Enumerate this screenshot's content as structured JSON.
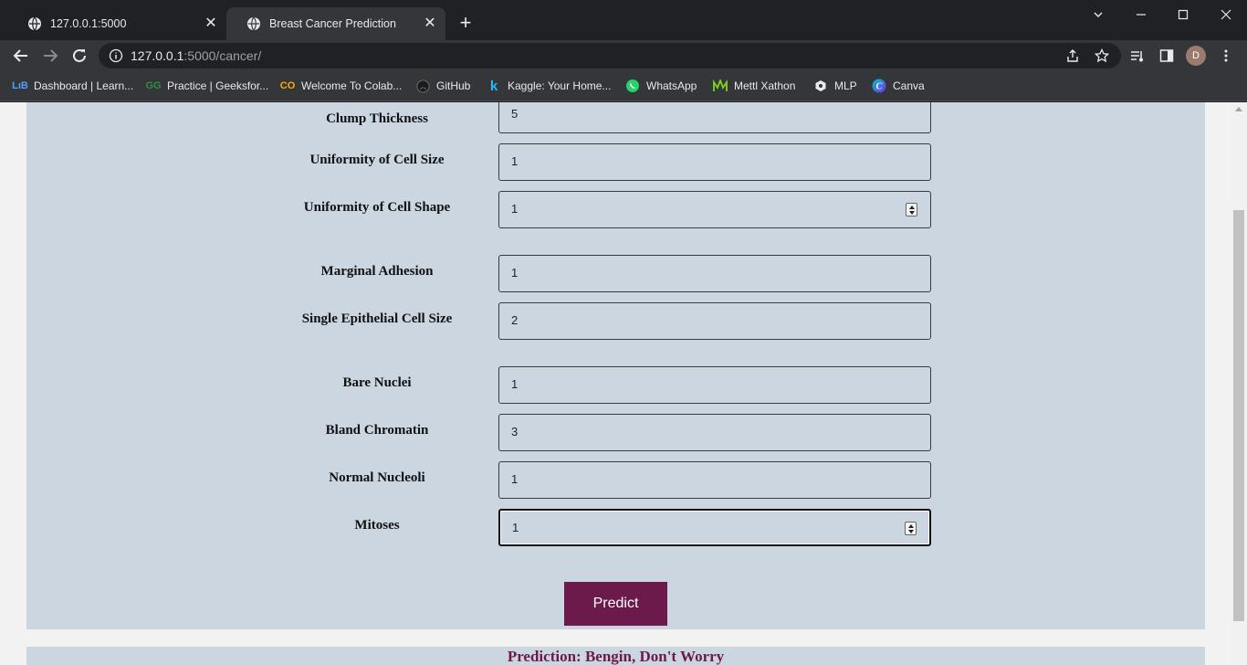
{
  "browser": {
    "tabs": [
      {
        "title": "127.0.0.1:5000"
      },
      {
        "title": "Breast Cancer Prediction"
      }
    ],
    "url_host": "127.0.0.1",
    "url_path": ":5000/cancer/",
    "avatar_letter": "D",
    "bookmarks": [
      {
        "label": "Dashboard | Learn...",
        "icon": "LıB"
      },
      {
        "label": "Practice | Geeksfor...",
        "icon": "GG"
      },
      {
        "label": "Welcome To Colab...",
        "icon": "CO"
      },
      {
        "label": "GitHub",
        "icon": "github-icon"
      },
      {
        "label": "Kaggle: Your Home...",
        "icon": "k"
      },
      {
        "label": "WhatsApp",
        "icon": "whatsapp-icon"
      },
      {
        "label": "Mettl Xathon",
        "icon": "mettl-icon"
      },
      {
        "label": "MLP",
        "icon": "mlp-icon"
      },
      {
        "label": "Canva",
        "icon": "C"
      }
    ]
  },
  "form": {
    "fields": [
      {
        "label": "Clump Thickness",
        "value": "5",
        "spinner": false
      },
      {
        "label": "Uniformity of Cell Size",
        "value": "1",
        "spinner": false
      },
      {
        "label": "Uniformity of Cell Shape",
        "value": "1",
        "spinner": true
      },
      {
        "label": "Marginal Adhesion",
        "value": "1",
        "spinner": false
      },
      {
        "label": "Single Epithelial Cell Size",
        "value": "2",
        "spinner": false
      },
      {
        "label": "Bare Nuclei",
        "value": "1",
        "spinner": false
      },
      {
        "label": "Bland Chromatin",
        "value": "3",
        "spinner": false
      },
      {
        "label": "Normal Nucleoli",
        "value": "1",
        "spinner": false
      },
      {
        "label": "Mitoses",
        "value": "1",
        "spinner": true
      }
    ],
    "predict_label": "Predict"
  },
  "result": {
    "text": "Prediction: Bengin, Don't Worry"
  },
  "colors": {
    "accent": "#6b1a4b",
    "card_bg": "#ccd6e1",
    "page_bg": "#f2f2f2"
  }
}
